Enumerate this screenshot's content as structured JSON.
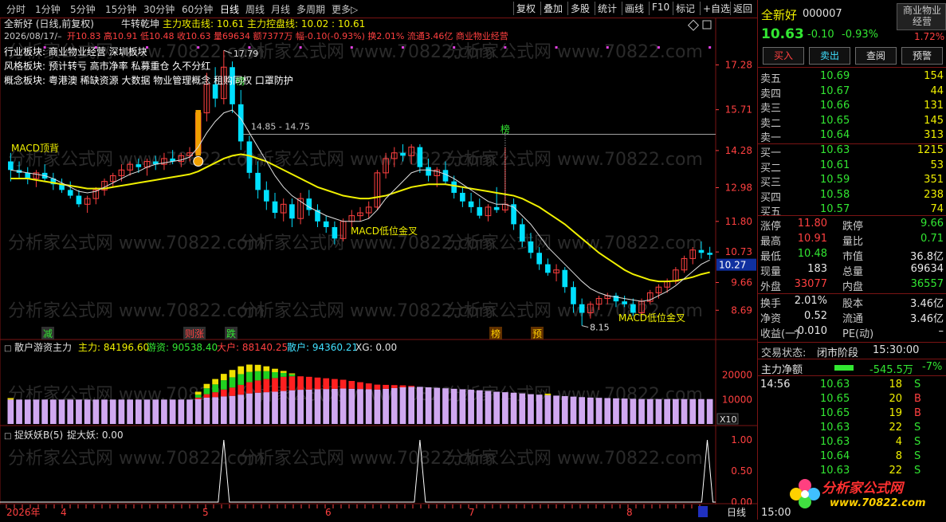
{
  "toolbar": {
    "periods": [
      "分时",
      "1分钟",
      "5分钟",
      "15分钟",
      "30分钟",
      "60分钟",
      "日线",
      "周线",
      "月线",
      "多周期",
      "更多▷"
    ],
    "active_period": "日线",
    "right_buttons": [
      "复权",
      "叠加",
      "多股",
      "统计",
      "画线",
      "F10",
      "标记",
      "+自选",
      "返回"
    ]
  },
  "chart": {
    "header_left": "全新好 (日线,前复权)",
    "indicator_title": "牛转乾坤",
    "indicator_values": "主力攻击线: 10.61  主力控盘线: 10.02 : 10.61",
    "info_line_date": "2026/08/17/–",
    "info_line": "开10.83 高10.91 低10.48 收10.63 量69634 额7377万 幅-0.10(-0.93%) 换2.01% 流通3.46亿 商业物业经营",
    "industry_block": "行业板块: 商业物业经营 深圳板块",
    "style_block": "风格板块: 预计转亏 高市净率 私募重仓 久不分红",
    "concept_block": "概念板块: 粤港澳 稀缺资源 大数据 物业管理概念 租购同权 口罩防护",
    "price_axis": [
      "17.28",
      "15.71",
      "14.28",
      "12.98",
      "11.80",
      "10.73",
      "9.66",
      "8.69"
    ],
    "current_price_tag": "10.27",
    "high_label": "17.79",
    "low_label": "8.15",
    "range_label": "14.85 - 14.75",
    "annotations": {
      "macd_top": "MACD顶背",
      "macd_gold1": "MACD低位金叉",
      "macd_gold2": "MACD低位金叉",
      "bang1": "榜",
      "bang2": "榜",
      "bang_bottom": "榜",
      "jian": "减",
      "zhang": "则涨",
      "die": "跌",
      "yu": "预"
    },
    "sub1_title": "散户游资主力",
    "sub1_values": {
      "zhuli": "主力: 84196.60",
      "youzi": "游资: 90538.40",
      "dahu": "大户: 88140.25",
      "sanhu": "散户: 94360.21",
      "xg": "XG: 0.00"
    },
    "sub1_axis": [
      "20000",
      "10000"
    ],
    "sub1_unit": "X10",
    "sub2_title": "捉妖妖B(5)",
    "sub2_values": "捉大妖: 0.00",
    "sub2_axis": [
      "1.00",
      "0.50",
      "0.00"
    ],
    "x_axis": [
      "2026年",
      "4",
      "5",
      "6",
      "7",
      "8"
    ],
    "x_period": "日线",
    "watermark": "分析家公式网 www.70822.com",
    "logo_text": "分析家公式网",
    "logo_url": "www.70822.com"
  },
  "stock": {
    "name": "全新好",
    "code": "000007",
    "industry_badge": "商业物业经营",
    "badge_pct": "1.72%",
    "price": "10.63",
    "change": "-0.10",
    "change_pct": "-0.93%",
    "buttons": [
      "买入",
      "卖出",
      "查阅",
      "预警"
    ],
    "sell": [
      {
        "label": "卖五",
        "price": "10.69",
        "vol": "154"
      },
      {
        "label": "卖四",
        "price": "10.67",
        "vol": "44"
      },
      {
        "label": "卖三",
        "price": "10.66",
        "vol": "131"
      },
      {
        "label": "卖二",
        "price": "10.65",
        "vol": "145"
      },
      {
        "label": "卖一",
        "price": "10.64",
        "vol": "313"
      }
    ],
    "buy": [
      {
        "label": "买一",
        "price": "10.63",
        "vol": "1215"
      },
      {
        "label": "买二",
        "price": "10.61",
        "vol": "53"
      },
      {
        "label": "买三",
        "price": "10.59",
        "vol": "351"
      },
      {
        "label": "买四",
        "price": "10.58",
        "vol": "238"
      },
      {
        "label": "买五",
        "price": "10.57",
        "vol": "74"
      }
    ],
    "stats": [
      {
        "l1": "涨停",
        "v1": "11.80",
        "l2": "跌停",
        "v2": "9.66"
      },
      {
        "l1": "最高",
        "v1": "10.91",
        "l2": "量比",
        "v2": "0.71"
      },
      {
        "l1": "最低",
        "v1": "10.48",
        "l2": "市值",
        "v2": "36.8亿"
      },
      {
        "l1": "现量",
        "v1": "183",
        "l2": "总量",
        "v2": "69634"
      },
      {
        "l1": "外盘",
        "v1": "33077",
        "l2": "内盘",
        "v2": "36557"
      }
    ],
    "stats2": [
      {
        "l1": "换手",
        "v1": "2.01%",
        "l2": "股本",
        "v2": "3.46亿"
      },
      {
        "l1": "净资",
        "v1": "0.52",
        "l2": "流通",
        "v2": "3.46亿"
      },
      {
        "l1": "收益(一)",
        "v1": "-0.010",
        "l2": "PE(动)",
        "v2": "–"
      }
    ],
    "trade_status_label": "交易状态:",
    "trade_status": "闭市阶段",
    "trade_time": "15:30:00",
    "net_flow_label": "主力净额",
    "net_flow": "-545.5万",
    "net_flow_pct": "-7%",
    "ticks": [
      {
        "time": "14:56",
        "price": "10.63",
        "vol": "18",
        "bs": "S"
      },
      {
        "time": "",
        "price": "10.65",
        "vol": "20",
        "bs": "B"
      },
      {
        "time": "",
        "price": "10.65",
        "vol": "19",
        "bs": "B"
      },
      {
        "time": "",
        "price": "10.63",
        "vol": "22",
        "bs": "S"
      },
      {
        "time": "",
        "price": "10.63",
        "vol": "4",
        "bs": "S"
      },
      {
        "time": "",
        "price": "10.64",
        "vol": "8",
        "bs": "S"
      },
      {
        "time": "",
        "price": "10.63",
        "vol": "22",
        "bs": "S"
      }
    ],
    "bottom_time": "15:00"
  },
  "colors": {
    "up": "#ff4040",
    "down": "#00e0ff",
    "ma_yellow": "#f0f000",
    "ma_white": "#e0e0e0",
    "vol_purple": "#d0a8f0",
    "vol_red": "#ff2020",
    "vol_green": "#20d020",
    "vol_yellow": "#f0e000"
  },
  "chart_data": {
    "type": "candlestick",
    "x": [
      "2026年",
      "4",
      "5",
      "6",
      "7",
      "8"
    ],
    "ylim": [
      8.15,
      17.79
    ],
    "y_ticks": [
      17.28,
      15.71,
      14.28,
      12.98,
      11.8,
      10.73,
      9.66,
      8.69
    ],
    "candles": [
      [
        13.9,
        14.2,
        13.2,
        13.6
      ],
      [
        13.6,
        13.9,
        13.3,
        13.5
      ],
      [
        13.5,
        13.7,
        13.1,
        13.3
      ],
      [
        13.3,
        13.6,
        13.0,
        13.5
      ],
      [
        13.5,
        13.8,
        13.2,
        13.3
      ],
      [
        13.3,
        13.5,
        12.9,
        13.1
      ],
      [
        13.1,
        13.3,
        12.8,
        12.9
      ],
      [
        12.9,
        13.2,
        12.6,
        12.7
      ],
      [
        12.7,
        12.9,
        12.3,
        12.4
      ],
      [
        12.4,
        12.7,
        12.1,
        12.6
      ],
      [
        12.6,
        13.0,
        12.4,
        12.9
      ],
      [
        12.9,
        13.3,
        12.7,
        13.2
      ],
      [
        13.2,
        13.5,
        13.0,
        13.4
      ],
      [
        13.4,
        13.8,
        13.2,
        13.6
      ],
      [
        13.6,
        13.9,
        13.4,
        13.8
      ],
      [
        13.8,
        14.0,
        13.5,
        13.7
      ],
      [
        13.7,
        14.0,
        13.4,
        13.9
      ],
      [
        13.9,
        14.1,
        13.6,
        13.8
      ],
      [
        13.8,
        14.2,
        13.6,
        14.0
      ],
      [
        14.0,
        14.3,
        13.8,
        13.9
      ],
      [
        13.9,
        14.2,
        13.7,
        14.1
      ],
      [
        14.1,
        14.4,
        13.9,
        14.2
      ],
      [
        14.2,
        15.6,
        14.1,
        15.6
      ],
      [
        15.6,
        17.0,
        15.3,
        16.6
      ],
      [
        16.6,
        17.2,
        15.8,
        16.1
      ],
      [
        16.1,
        17.79,
        15.9,
        17.2
      ],
      [
        17.2,
        17.4,
        15.6,
        15.9
      ],
      [
        15.9,
        16.4,
        14.3,
        14.6
      ],
      [
        14.6,
        14.8,
        13.3,
        13.5
      ],
      [
        13.5,
        13.9,
        12.6,
        12.9
      ],
      [
        12.9,
        13.2,
        12.2,
        12.5
      ],
      [
        12.5,
        12.8,
        11.9,
        12.1
      ],
      [
        12.1,
        12.6,
        11.8,
        12.4
      ],
      [
        12.4,
        12.6,
        11.6,
        11.9
      ],
      [
        11.9,
        12.8,
        11.7,
        12.6
      ],
      [
        12.6,
        12.9,
        12.0,
        12.2
      ],
      [
        12.2,
        12.4,
        11.6,
        11.8
      ],
      [
        11.8,
        12.0,
        11.4,
        11.6
      ],
      [
        11.6,
        11.8,
        11.0,
        11.2
      ],
      [
        11.2,
        11.9,
        11.1,
        11.8
      ],
      [
        11.8,
        12.2,
        11.6,
        12.0
      ],
      [
        12.0,
        12.3,
        11.8,
        12.1
      ],
      [
        12.1,
        12.5,
        11.9,
        12.3
      ],
      [
        12.3,
        13.6,
        12.2,
        13.5
      ],
      [
        13.5,
        14.2,
        13.3,
        14.0
      ],
      [
        14.0,
        14.4,
        13.7,
        14.2
      ],
      [
        14.2,
        14.5,
        13.9,
        14.1
      ],
      [
        14.1,
        14.5,
        13.8,
        14.4
      ],
      [
        14.4,
        14.5,
        13.5,
        13.7
      ],
      [
        13.7,
        14.0,
        13.2,
        13.4
      ],
      [
        13.4,
        13.7,
        13.0,
        13.6
      ],
      [
        13.6,
        13.9,
        13.1,
        13.2
      ],
      [
        13.2,
        13.4,
        12.6,
        12.8
      ],
      [
        12.8,
        13.0,
        12.3,
        12.5
      ],
      [
        12.5,
        12.8,
        12.1,
        12.3
      ],
      [
        12.3,
        12.6,
        11.9,
        12.0
      ],
      [
        12.0,
        12.4,
        11.8,
        12.3
      ],
      [
        12.3,
        13.0,
        12.1,
        12.2
      ],
      [
        12.2,
        14.4,
        12.1,
        12.4
      ],
      [
        12.4,
        12.6,
        11.5,
        11.7
      ],
      [
        11.7,
        11.9,
        10.9,
        11.1
      ],
      [
        11.1,
        11.4,
        10.5,
        10.7
      ],
      [
        10.7,
        10.9,
        10.1,
        10.3
      ],
      [
        10.3,
        10.5,
        9.9,
        10.0
      ],
      [
        10.0,
        10.3,
        9.7,
        10.1
      ],
      [
        10.1,
        10.2,
        9.3,
        9.5
      ],
      [
        9.5,
        9.7,
        8.6,
        8.9
      ],
      [
        8.9,
        9.1,
        8.15,
        8.6
      ],
      [
        8.6,
        9.0,
        8.4,
        8.9
      ],
      [
        8.9,
        9.2,
        8.7,
        9.1
      ],
      [
        9.1,
        9.3,
        8.9,
        9.2
      ],
      [
        9.2,
        9.3,
        8.8,
        9.0
      ],
      [
        9.0,
        9.2,
        8.8,
        8.9
      ],
      [
        8.9,
        9.1,
        8.5,
        8.6
      ],
      [
        8.6,
        9.1,
        8.5,
        9.0
      ],
      [
        9.0,
        9.4,
        8.9,
        9.3
      ],
      [
        9.3,
        9.6,
        9.1,
        9.5
      ],
      [
        9.5,
        9.8,
        9.3,
        9.7
      ],
      [
        9.7,
        10.2,
        9.6,
        10.1
      ],
      [
        10.1,
        10.6,
        10.0,
        10.5
      ],
      [
        10.5,
        10.9,
        10.3,
        10.8
      ],
      [
        10.8,
        11.1,
        10.5,
        10.7
      ],
      [
        10.7,
        10.91,
        10.48,
        10.63
      ]
    ],
    "ma_white": [
      13.6,
      13.55,
      13.5,
      13.45,
      13.4,
      13.3,
      13.15,
      13.0,
      12.85,
      12.8,
      12.85,
      13.0,
      13.15,
      13.3,
      13.45,
      13.55,
      13.7,
      13.8,
      13.85,
      13.9,
      13.95,
      14.05,
      14.4,
      14.9,
      15.3,
      15.6,
      15.7,
      15.4,
      14.9,
      14.4,
      13.9,
      13.4,
      13.0,
      12.7,
      12.5,
      12.3,
      12.15,
      12.0,
      11.9,
      11.8,
      11.8,
      11.8,
      11.9,
      12.2,
      12.6,
      12.9,
      13.2,
      13.5,
      13.6,
      13.6,
      13.55,
      13.45,
      13.3,
      13.1,
      12.9,
      12.7,
      12.5,
      12.4,
      12.4,
      12.3,
      12.0,
      11.7,
      11.3,
      10.9,
      10.6,
      10.3,
      10.0,
      9.7,
      9.45,
      9.3,
      9.2,
      9.15,
      9.1,
      9.05,
      9.0,
      9.05,
      9.2,
      9.35,
      9.55,
      9.8,
      10.05,
      10.3,
      10.45
    ],
    "ma_yellow": [
      13.3,
      13.3,
      13.3,
      13.25,
      13.2,
      13.15,
      13.1,
      13.05,
      13.0,
      12.95,
      12.95,
      12.95,
      13.0,
      13.05,
      13.1,
      13.15,
      13.2,
      13.25,
      13.3,
      13.35,
      13.4,
      13.45,
      13.55,
      13.7,
      13.85,
      14.0,
      14.1,
      14.15,
      14.1,
      14.0,
      13.9,
      13.75,
      13.6,
      13.45,
      13.3,
      13.15,
      13.0,
      12.9,
      12.8,
      12.7,
      12.65,
      12.6,
      12.6,
      12.65,
      12.7,
      12.8,
      12.9,
      13.0,
      13.05,
      13.1,
      13.1,
      13.1,
      13.05,
      13.0,
      12.95,
      12.9,
      12.85,
      12.8,
      12.75,
      12.7,
      12.6,
      12.45,
      12.3,
      12.1,
      11.9,
      11.7,
      11.45,
      11.2,
      10.95,
      10.7,
      10.5,
      10.3,
      10.1,
      9.95,
      9.85,
      9.75,
      9.7,
      9.7,
      9.72,
      9.78,
      9.85,
      9.95,
      10.02
    ],
    "sub1": {
      "series": [
        {
          "name": "散户",
          "values": [
            10000,
            10000,
            10000,
            10000,
            10000,
            10000,
            10000,
            10000,
            10000,
            10000,
            10000,
            10000,
            10000,
            10000,
            10000,
            10000,
            10000,
            10000,
            10000,
            10000,
            10000,
            10000,
            10200,
            10800,
            11000,
            11300,
            11500,
            12000,
            12500,
            12800,
            13000,
            13200,
            13500,
            13800,
            14000,
            14100,
            14200,
            14300,
            14400,
            14500,
            14400,
            14300,
            14200,
            14100,
            14400,
            14700,
            15000,
            15200,
            15200,
            15000,
            14800,
            14600,
            14400,
            14200,
            14000,
            13800,
            13500,
            13200,
            13000,
            12800,
            12500,
            12200,
            12000,
            11800,
            11600,
            11400,
            11200,
            11000,
            10800,
            10700,
            10600,
            10500,
            10400,
            10300,
            10200,
            10200,
            10200,
            10200,
            10200,
            10200,
            10200,
            10200,
            10200
          ]
        },
        {
          "name": "大户",
          "values": [
            0,
            0,
            0,
            0,
            0,
            0,
            0,
            0,
            0,
            0,
            0,
            0,
            0,
            0,
            0,
            0,
            0,
            0,
            0,
            0,
            0,
            0,
            600,
            1400,
            2000,
            2800,
            3400,
            4000,
            4600,
            5000,
            5400,
            5600,
            5800,
            5700,
            5500,
            5200,
            4800,
            4400,
            4000,
            3600,
            3200,
            2800,
            2400,
            2000,
            1600,
            1200,
            800,
            400,
            0,
            0,
            0,
            0,
            0,
            0,
            0,
            0,
            0,
            0,
            0,
            0,
            0,
            0,
            0,
            0,
            0,
            0,
            0,
            0,
            0,
            0,
            0,
            0,
            0,
            0,
            0,
            0,
            0,
            0,
            0,
            0,
            0,
            0,
            0
          ]
        },
        {
          "name": "游资",
          "values": [
            0,
            0,
            0,
            0,
            0,
            0,
            0,
            0,
            0,
            0,
            0,
            0,
            0,
            0,
            0,
            0,
            0,
            0,
            0,
            0,
            0,
            0,
            1200,
            2400,
            3200,
            3800,
            4200,
            4400,
            4200,
            3800,
            3200,
            2400,
            1600,
            800,
            0,
            0,
            0,
            0,
            0,
            0,
            0,
            0,
            0,
            0,
            0,
            0,
            0,
            0,
            0,
            0,
            0,
            0,
            0,
            0,
            0,
            0,
            0,
            0,
            0,
            0,
            0,
            0,
            0,
            0,
            0,
            0,
            0,
            0,
            0,
            0,
            0,
            0,
            0,
            0,
            0,
            0,
            0,
            0,
            0,
            0,
            0,
            0,
            0
          ]
        },
        {
          "name": "主力",
          "values": [
            600,
            0,
            0,
            0,
            0,
            0,
            0,
            0,
            0,
            0,
            0,
            0,
            0,
            0,
            0,
            0,
            0,
            0,
            0,
            0,
            0,
            0,
            1200,
            1800,
            2200,
            2600,
            3000,
            3200,
            3000,
            2600,
            2000,
            1400,
            800,
            400,
            0,
            0,
            0,
            0,
            0,
            0,
            0,
            0,
            0,
            0,
            0,
            0,
            0,
            0,
            0,
            0,
            0,
            0,
            0,
            0,
            0,
            0,
            0,
            0,
            0,
            0,
            0,
            0,
            0,
            600,
            0,
            0,
            0,
            0,
            0,
            0,
            0,
            0,
            0,
            0,
            0,
            0,
            0,
            0,
            0,
            0,
            0,
            0,
            0
          ]
        }
      ]
    },
    "sub2": {
      "spikes_at": [
        25,
        48,
        87
      ],
      "values_note": "捉大妖"
    }
  }
}
